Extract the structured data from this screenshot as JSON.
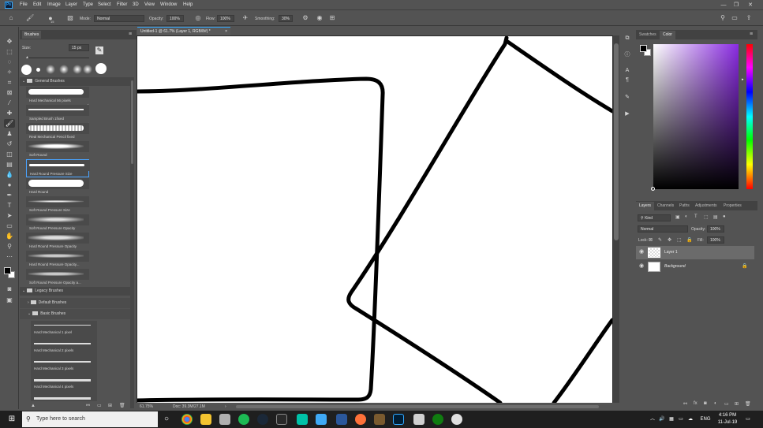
{
  "menubar": {
    "logo": "Ps",
    "items": [
      "File",
      "Edit",
      "Image",
      "Layer",
      "Type",
      "Select",
      "Filter",
      "3D",
      "View",
      "Window",
      "Help"
    ],
    "window_controls": [
      "—",
      "❐",
      "✕"
    ]
  },
  "options": {
    "brush_size": "15",
    "mode_label": "Mode:",
    "mode_value": "Normal",
    "opacity_label": "Opacity:",
    "opacity_value": "100%",
    "flow_label": "Flow:",
    "flow_value": "100%",
    "smoothing_label": "Smoothing:",
    "smoothing_value": "30%"
  },
  "brushes_panel": {
    "tab": "Brushes",
    "size_label": "Size:",
    "size_value": "15 px",
    "group_general": "General Brushes",
    "items": [
      "Hard Mechanical 56 pixels",
      "Sampled Brush 1fixed",
      "Real Mechanical Pencil fixed",
      "Soft Round",
      "Hard Round Pressure Size",
      "Hard Round",
      "Soft Round Pressure Size",
      "Soft Round Pressure Opacity",
      "Hard Round Pressure Opacity",
      "Hard Round Pressure Opacity...",
      "Soft Round Pressure Opacity a..."
    ],
    "group_legacy": "Legacy Brushes",
    "sub_default": "Default Brushes",
    "sub_basic": "Basic Brushes",
    "legacy_items": [
      "Hard Mechanical 1 pixel",
      "Hard Mechanical 2 pixels",
      "Hard Mechanical 3 pixels",
      "Hard Mechanical 4 pixels"
    ]
  },
  "document": {
    "tab_title": "Untitled-1 @ 61.7% (Layer 1, RGB/8#) *",
    "zoom": "61.75%",
    "doc_info": "Doc: 39.3M/27.1M"
  },
  "color_panel": {
    "tabs": [
      "Swatches",
      "Color"
    ],
    "active_tab": "Color",
    "foreground": "#000000",
    "background": "#ffffff"
  },
  "layers_panel": {
    "tabs": [
      "Layers",
      "Channels",
      "Paths",
      "Adjustments",
      "Properties"
    ],
    "filter_kind": "Kind",
    "blend_mode": "Normal",
    "opacity_label": "Opacity:",
    "opacity_value": "100%",
    "lock_label": "Lock:",
    "fill_label": "Fill:",
    "fill_value": "100%",
    "layers": [
      {
        "name": "Layer 1",
        "selected": true
      },
      {
        "name": "Background",
        "selected": false,
        "locked": true
      }
    ]
  },
  "taskbar": {
    "search_placeholder": "Type here to search",
    "language": "ENG",
    "time": "4:16 PM",
    "date": "11-Jul-19"
  }
}
